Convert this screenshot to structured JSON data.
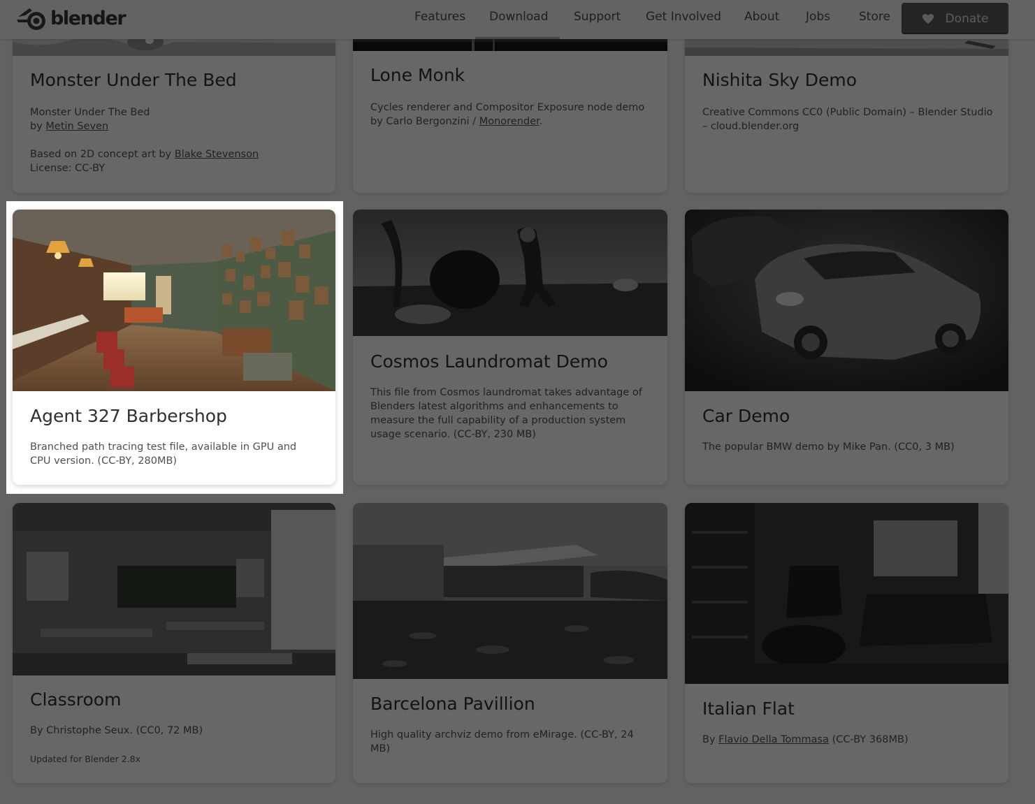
{
  "header": {
    "logo_text": "blender",
    "nav": [
      "Features",
      "Download",
      "Support",
      "Get Involved",
      "About",
      "Jobs",
      "Store"
    ],
    "active_nav": "Download",
    "donate_label": "Donate",
    "donate_icon": "heart-icon"
  },
  "cards": {
    "monster": {
      "title": "Monster Under The Bed",
      "line1": "Monster Under The Bed",
      "by_prefix": "by ",
      "author": "Metin Seven",
      "based_prefix": "Based on 2D concept art by ",
      "concept_artist": "Blake Stevenson",
      "license": "License: CC-BY"
    },
    "lone_monk": {
      "title": "Lone Monk",
      "text_line1": "Cycles renderer and Compositor Exposure node demo",
      "by_prefix": "by Carlo Bergonzini / ",
      "link": "Monorender",
      "suffix": "."
    },
    "nishita": {
      "title": "Nishita Sky Demo",
      "text": "Creative Commons CC0 (Public Domain) – Blender Studio – cloud.blender.org"
    },
    "agent327": {
      "title": "Agent 327 Barbershop",
      "text": "Branched path tracing test file, available in GPU and CPU version. (CC-BY, 280MB)"
    },
    "cosmos": {
      "title": "Cosmos Laundromat Demo",
      "text": "This file from Cosmos laundromat takes advantage of Blenders latest algorithms and enhancements to measure the full capability of a production system usage scenario. (CC-BY, 230 MB)"
    },
    "car": {
      "title": "Car Demo",
      "text": "The popular BMW demo by Mike Pan. (CC0, 3 MB)"
    },
    "classroom": {
      "title": "Classroom",
      "text": "By Christophe Seux. (CC0, 72 MB)",
      "note": "Updated for Blender 2.8x"
    },
    "barcelona": {
      "title": "Barcelona Pavillion",
      "text": "High quality archviz demo from eMirage. (CC-BY, 24 MB)"
    },
    "italian": {
      "title": "Italian Flat",
      "by_prefix": "By ",
      "author": "Flavio Della Tommasa",
      "suffix": " (CC-BY 368MB)"
    }
  },
  "colors": {
    "page_bg": "#e9e9e9",
    "card_bg": "#f6f6f6",
    "dim_overlay": "rgba(0,0,0,0.58)",
    "donate_bg": "#5a5a5a"
  }
}
